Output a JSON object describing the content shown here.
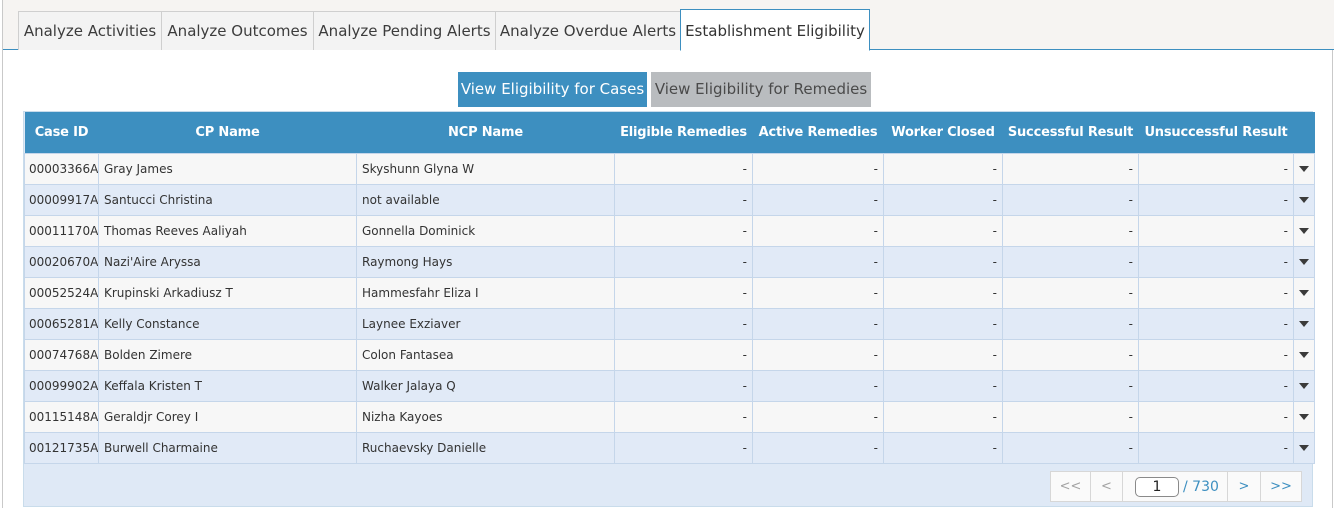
{
  "tabs": [
    {
      "label": "Analyze Activities"
    },
    {
      "label": "Analyze Outcomes"
    },
    {
      "label": "Analyze Pending Alerts"
    },
    {
      "label": "Analyze Overdue Alerts"
    },
    {
      "label": "Establishment Eligibility",
      "active": true
    }
  ],
  "toggle": {
    "cases_label": "View Eligibility for Cases",
    "remedies_label": "View Eligibility for Remedies"
  },
  "table": {
    "headers": [
      "Case ID",
      "CP Name",
      "NCP Name",
      "Eligible Remedies",
      "Active Remedies",
      "Worker Closed",
      "Successful Result",
      "Unsuccessful Result"
    ],
    "rows": [
      {
        "case_id": "00003366A",
        "cp_name": "Gray James",
        "ncp_name": "Skyshunn Glyna W",
        "eligible": "-",
        "active": "-",
        "closed": "-",
        "success": "-",
        "unsuccess": "-"
      },
      {
        "case_id": "00009917A",
        "cp_name": "Santucci Christina",
        "ncp_name": "not available",
        "eligible": "-",
        "active": "-",
        "closed": "-",
        "success": "-",
        "unsuccess": "-"
      },
      {
        "case_id": "00011170A",
        "cp_name": "Thomas Reeves Aaliyah",
        "ncp_name": "Gonnella Dominick",
        "eligible": "-",
        "active": "-",
        "closed": "-",
        "success": "-",
        "unsuccess": "-"
      },
      {
        "case_id": "00020670A",
        "cp_name": "Nazi'Aire Aryssa",
        "ncp_name": "Raymong Hays",
        "eligible": "-",
        "active": "-",
        "closed": "-",
        "success": "-",
        "unsuccess": "-"
      },
      {
        "case_id": "00052524A",
        "cp_name": "Krupinski Arkadiusz T",
        "ncp_name": "Hammesfahr Eliza I",
        "eligible": "-",
        "active": "-",
        "closed": "-",
        "success": "-",
        "unsuccess": "-"
      },
      {
        "case_id": "00065281A",
        "cp_name": "Kelly Constance",
        "ncp_name": "Laynee Exziaver",
        "eligible": "-",
        "active": "-",
        "closed": "-",
        "success": "-",
        "unsuccess": "-"
      },
      {
        "case_id": "00074768A",
        "cp_name": "Bolden Zimere",
        "ncp_name": "Colon Fantasea",
        "eligible": "-",
        "active": "-",
        "closed": "-",
        "success": "-",
        "unsuccess": "-"
      },
      {
        "case_id": "00099902A",
        "cp_name": "Keffala Kristen T",
        "ncp_name": "Walker Jalaya Q",
        "eligible": "-",
        "active": "-",
        "closed": "-",
        "success": "-",
        "unsuccess": "-"
      },
      {
        "case_id": "00115148A",
        "cp_name": "Geraldjr Corey I",
        "ncp_name": "Nizha Kayoes",
        "eligible": "-",
        "active": "-",
        "closed": "-",
        "success": "-",
        "unsuccess": "-"
      },
      {
        "case_id": "00121735A",
        "cp_name": "Burwell Charmaine",
        "ncp_name": "Ruchaevsky Danielle",
        "eligible": "-",
        "active": "-",
        "closed": "-",
        "success": "-",
        "unsuccess": "-"
      }
    ]
  },
  "pager": {
    "first": "<<",
    "prev": "<",
    "page": "1",
    "total": "/ 730",
    "next": ">",
    "last": ">>"
  },
  "colors": {
    "accent": "#3d8fc0",
    "inactive_button": "#b9bcbf",
    "row_alt": "#e1eaf7"
  },
  "icons": {
    "row_expand": "caret-down-icon"
  }
}
